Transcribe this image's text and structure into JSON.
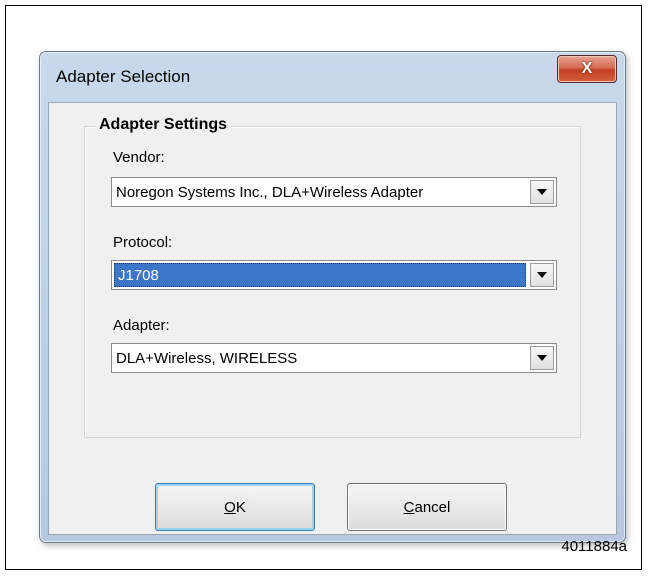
{
  "window": {
    "title": "Adapter Selection",
    "close_glyph": "X"
  },
  "group": {
    "title": "Adapter Settings"
  },
  "fields": {
    "vendor": {
      "label": "Vendor:",
      "value": "Noregon Systems Inc., DLA+Wireless Adapter"
    },
    "protocol": {
      "label": "Protocol:",
      "value": "J1708"
    },
    "adapter": {
      "label": "Adapter:",
      "value": "DLA+Wireless, WIRELESS"
    }
  },
  "buttons": {
    "ok": {
      "mnemonic": "O",
      "rest": "K"
    },
    "cancel": {
      "mnemonic": "C",
      "rest": "ancel"
    }
  },
  "caption": "4011884a",
  "colors": {
    "selection": "#3b76c8",
    "close_button": "#c13f23",
    "window_frame": "#b6c9e0"
  }
}
